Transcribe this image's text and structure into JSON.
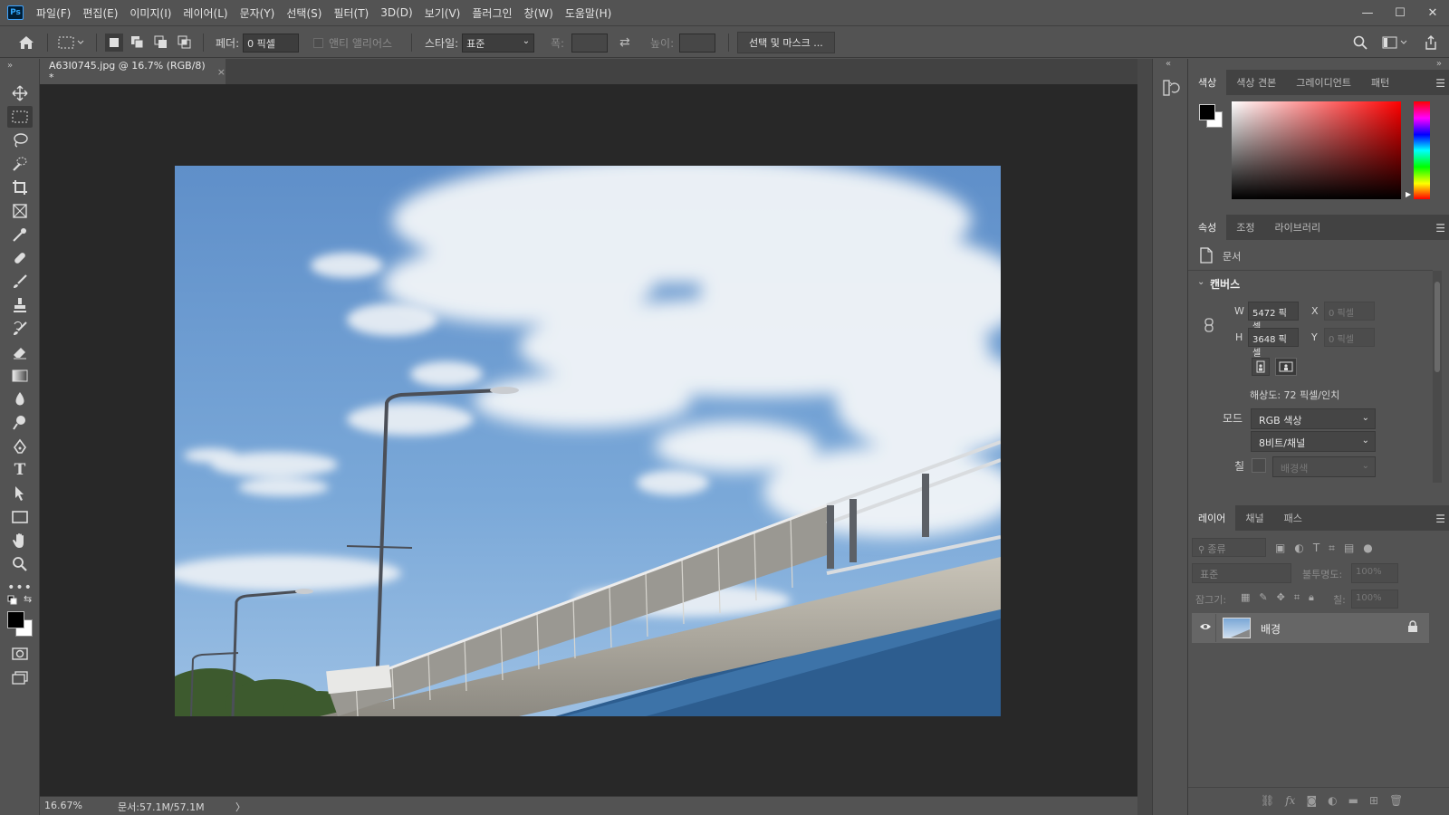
{
  "app": {
    "logo": "Ps"
  },
  "menu": [
    "파일(F)",
    "편집(E)",
    "이미지(I)",
    "레이어(L)",
    "문자(Y)",
    "선택(S)",
    "필터(T)",
    "3D(D)",
    "보기(V)",
    "플러그인",
    "창(W)",
    "도움말(H)"
  ],
  "window_controls": {
    "minimize": "—",
    "maximize": "☐",
    "close": "✕"
  },
  "options": {
    "feather_label": "페더:",
    "feather_value": "0 픽셀",
    "antialias_label": "앤티 앨리어스",
    "style_label": "스타일:",
    "style_value": "표준",
    "width_label": "폭:",
    "height_label": "높이:",
    "select_mask_button": "선택 및 마스크 ..."
  },
  "document": {
    "tab_title": "A63I0745.jpg @ 16.7% (RGB/8) *",
    "tab_close": "×"
  },
  "status": {
    "zoom": "16.67%",
    "doc_size": "문서:57.1M/57.1M",
    "arrow": "〉"
  },
  "color_panel": {
    "tabs": [
      "색상",
      "색상 견본",
      "그레이디언트",
      "패턴"
    ],
    "active_tab": 0,
    "hue_top": "#ff0000"
  },
  "properties_panel": {
    "tabs": [
      "속성",
      "조정",
      "라이브러리"
    ],
    "active_tab": 0,
    "doc_label": "문서",
    "canvas_label": "캔버스",
    "w_label": "W",
    "w_value": "5472 픽셀",
    "h_label": "H",
    "h_value": "3648 픽셀",
    "x_label": "X",
    "x_placeholder": "0 픽셀",
    "y_label": "Y",
    "y_placeholder": "0 픽셀",
    "resolution": "해상도: 72 픽셀/인치",
    "mode_label": "모드",
    "mode_value": "RGB 색상",
    "depth_value": "8비트/채널",
    "fill_label": "칠",
    "fill_value": "배경색"
  },
  "layers_panel": {
    "tabs": [
      "레이어",
      "채널",
      "패스"
    ],
    "active_tab": 0,
    "filter_placeholder": "종류",
    "blend_mode": "표준",
    "opacity_label": "불투명도:",
    "opacity_value": "100%",
    "lock_label": "잠그기:",
    "fill_label": "칠:",
    "fill_value": "100%",
    "layers": [
      {
        "name": "배경",
        "visible": true,
        "locked": true
      }
    ]
  },
  "colors": {
    "foreground": "#000000",
    "background": "#ffffff",
    "sky": "#6f9fd2"
  }
}
